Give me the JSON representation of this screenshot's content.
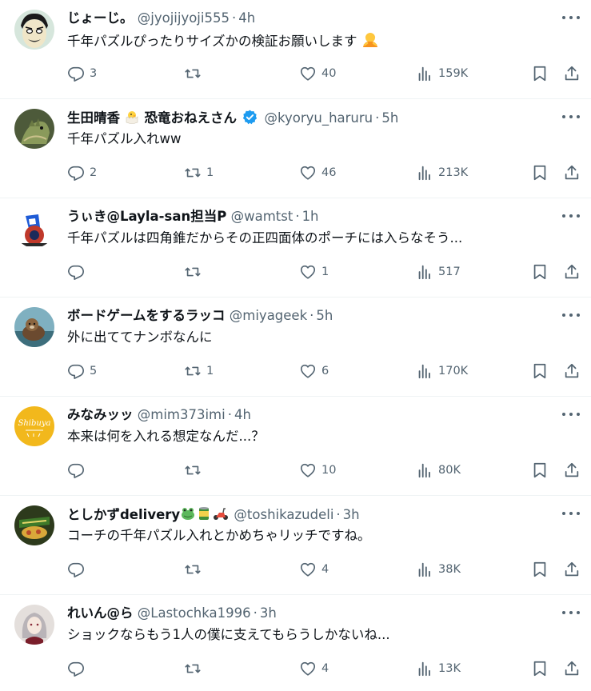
{
  "tweets": [
    {
      "name": "じょーじ。",
      "handle": "@jyojijyoji555",
      "sep": "·",
      "time": "4h",
      "text": "千年パズルぴったりサイズかの検証お願いします",
      "replies": "3",
      "retweets": "",
      "likes": "40",
      "views": "159K",
      "avatar_color": "#cfe0d6"
    },
    {
      "name": "生田晴香",
      "name_suffix": "恐竜おねえさん",
      "handle": "@kyoryu_haruru",
      "sep": "·",
      "time": "5h",
      "text": "千年パズル入れww",
      "replies": "2",
      "retweets": "1",
      "likes": "46",
      "views": "213K",
      "avatar_color": "#556b3d"
    },
    {
      "name": "うぃき@Layla-san担当P",
      "handle": "@wamtst",
      "sep": "·",
      "time": "1h",
      "text": "千年パズルは四角錐だからその正四面体のポーチには入らなそう...",
      "replies": "",
      "retweets": "",
      "likes": "1",
      "views": "517",
      "avatar_color": "#ffffff"
    },
    {
      "name": "ボードゲームをするラッコ",
      "handle": "@miyageek",
      "sep": "·",
      "time": "5h",
      "text": "外に出ててナンボなんに",
      "replies": "5",
      "retweets": "1",
      "likes": "6",
      "views": "170K",
      "avatar_color": "#8fb7c4"
    },
    {
      "name": "みなみッッ",
      "handle": "@mim373imi",
      "sep": "·",
      "time": "4h",
      "text": "本来は何を入れる想定なんだ...？",
      "replies": "",
      "retweets": "",
      "likes": "10",
      "views": "80K",
      "avatar_color": "#f2b81c",
      "avatar_text": "Shibuya"
    },
    {
      "name": "としかずdelivery",
      "handle": "@toshikazudeli",
      "sep": "·",
      "time": "3h",
      "text": "コーチの千年パズル入れとかめちゃリッチですね。",
      "replies": "",
      "retweets": "",
      "likes": "4",
      "views": "38K",
      "avatar_color": "#2f3a1f"
    },
    {
      "name": "れいん@ら",
      "handle": "@Lastochka1996",
      "sep": "·",
      "time": "3h",
      "text": "ショックならもう1人の僕に支えてもらうしかないね...",
      "replies": "",
      "retweets": "",
      "likes": "4",
      "views": "13K",
      "avatar_color": "#d9d4d2"
    }
  ],
  "icons": {
    "reply": "reply-icon",
    "retweet": "retweet-icon",
    "like": "heart-icon",
    "views": "views-icon",
    "bookmark": "bookmark-icon",
    "share": "share-icon",
    "more": "more-icon",
    "verified": "verified-badge-icon"
  },
  "colors": {
    "text": "#0f1419",
    "muted": "#536471",
    "verified": "#1d9bf0",
    "divider": "#eff3f4"
  }
}
